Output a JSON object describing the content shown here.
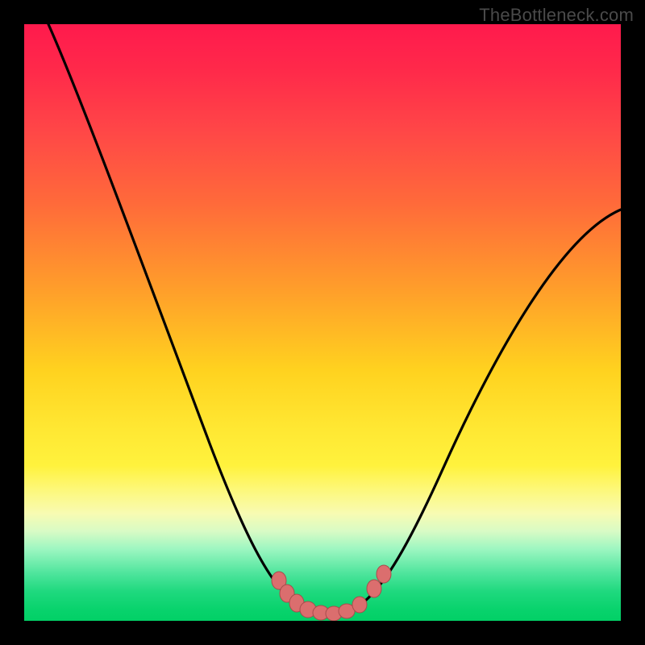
{
  "watermark": {
    "text": "TheBottleneck.com"
  },
  "chart_data": {
    "type": "line",
    "title": "",
    "xlabel": "",
    "ylabel": "",
    "xlim": [
      0,
      100
    ],
    "ylim": [
      0,
      100
    ],
    "grid": false,
    "legend": false,
    "background": {
      "gradient_direction": "vertical",
      "stops": [
        {
          "pos": 0.0,
          "color": "#ff1a4d"
        },
        {
          "pos": 0.3,
          "color": "#ff6a3a"
        },
        {
          "pos": 0.6,
          "color": "#ffe833"
        },
        {
          "pos": 0.82,
          "color": "#f8fbb2"
        },
        {
          "pos": 0.92,
          "color": "#4fe59d"
        },
        {
          "pos": 1.0,
          "color": "#02d066"
        }
      ]
    },
    "series": [
      {
        "name": "bottleneck-curve",
        "stroke": "#000000",
        "x": [
          4,
          10,
          16,
          22,
          28,
          34,
          38,
          42,
          45,
          48,
          50,
          52,
          55,
          58,
          62,
          68,
          74,
          80,
          86,
          92,
          98,
          100
        ],
        "values": [
          100,
          82,
          65,
          50,
          37,
          25,
          17,
          10,
          5,
          2,
          1,
          1,
          2,
          4,
          8,
          16,
          26,
          37,
          48,
          58,
          67,
          69
        ]
      }
    ],
    "markers": {
      "name": "flat-region-dots",
      "fill": "#db6e6e",
      "stroke": "#9a4040",
      "points": [
        {
          "x": 43,
          "y": 7
        },
        {
          "x": 45,
          "y": 4
        },
        {
          "x": 47,
          "y": 2
        },
        {
          "x": 49,
          "y": 1
        },
        {
          "x": 51,
          "y": 1
        },
        {
          "x": 53,
          "y": 1
        },
        {
          "x": 55,
          "y": 2
        },
        {
          "x": 58,
          "y": 4
        },
        {
          "x": 60,
          "y": 7
        },
        {
          "x": 62,
          "y": 9
        }
      ]
    }
  }
}
